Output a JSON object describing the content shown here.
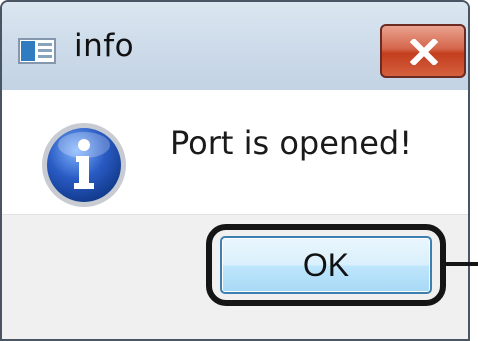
{
  "window": {
    "title": "info",
    "app_icon": "application-window-icon",
    "close_icon": "close-x-icon"
  },
  "message": {
    "icon": "information-icon",
    "text": "Port is opened!"
  },
  "buttons": {
    "ok_label": "OK"
  },
  "colors": {
    "titlebar": "#ccdae9",
    "close_button": "#c9472b",
    "ok_button": "#bee6fd",
    "info_icon": "#2a5bc4",
    "highlight_outline": "#151515"
  }
}
